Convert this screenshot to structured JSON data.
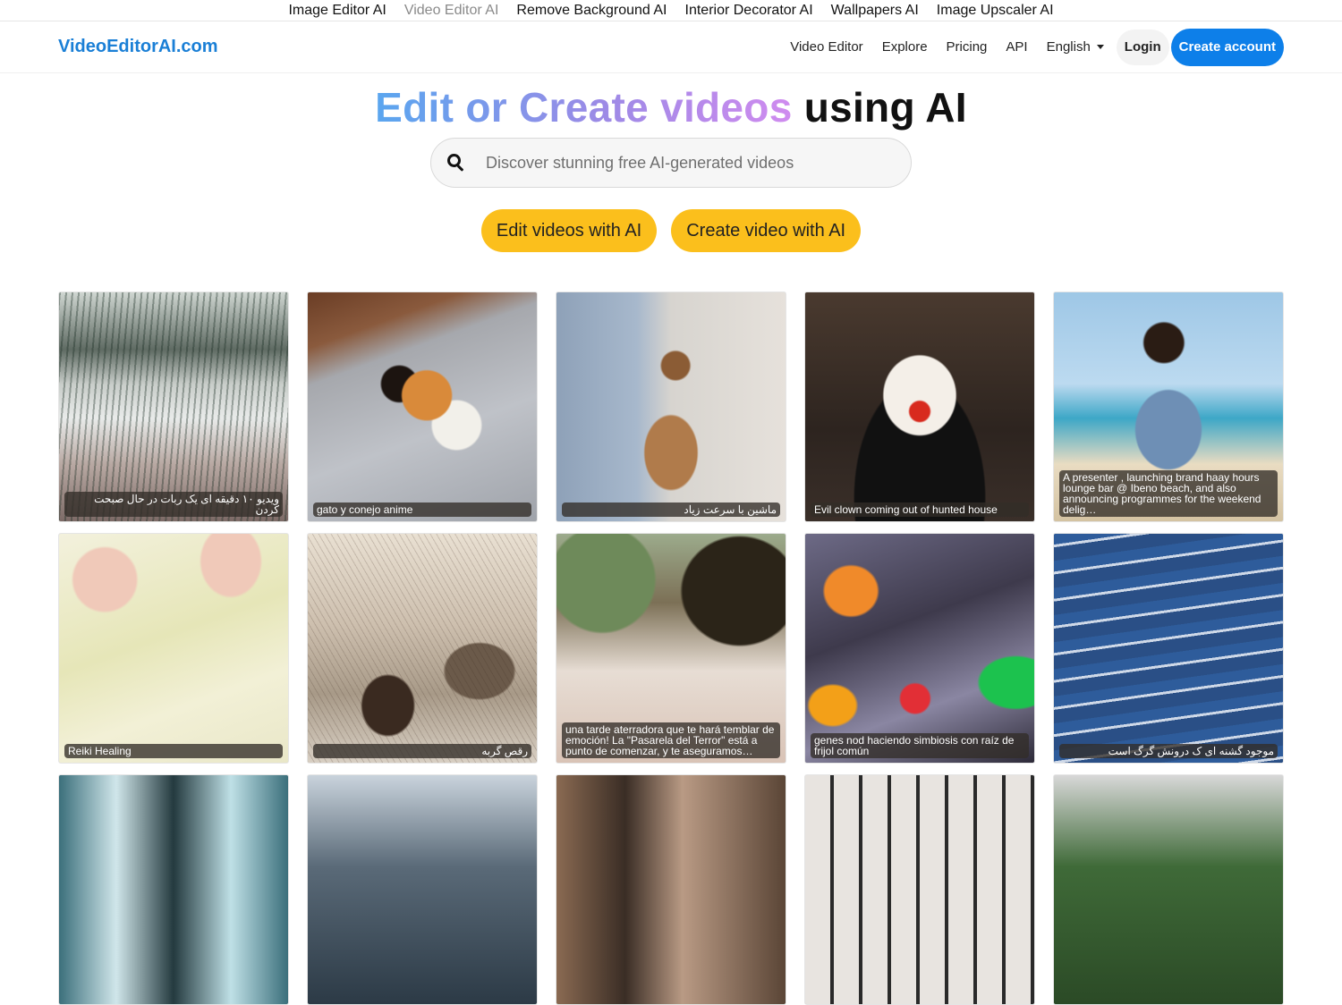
{
  "topbar": {
    "links": [
      "Image Editor AI",
      "Video Editor AI",
      "Remove Background AI",
      "Interior Decorator AI",
      "Wallpapers AI",
      "Image Upscaler AI"
    ],
    "active_index": 1
  },
  "nav": {
    "brand": "VideoEditorAI.com",
    "links": [
      "Video Editor",
      "Explore",
      "Pricing",
      "API"
    ],
    "language": "English",
    "login_label": "Login",
    "create_account_label": "Create account"
  },
  "hero": {
    "title_gradient": "Edit or Create videos",
    "title_plain": "using AI",
    "search_placeholder": "Discover stunning free AI-generated videos",
    "search_icon": "search-icon",
    "cta_edit": "Edit videos with AI",
    "cta_create": "Create video with AI"
  },
  "gallery": {
    "items": [
      {
        "caption": "ویدیو ۱۰ دقیقه ای یک ربات در حال صبحت کردن",
        "rtl": true
      },
      {
        "caption": "gato y conejo anime",
        "rtl": false
      },
      {
        "caption": "ماشین با سرعت زیاد",
        "rtl": true
      },
      {
        "caption": "Evil clown coming out of hunted house",
        "rtl": false
      },
      {
        "caption": "A presenter , launching brand haay hours lounge bar @ Ibeno beach, and also announcing programmes for the weekend delig…",
        "rtl": false
      },
      {
        "caption": "Reiki Healing",
        "rtl": false
      },
      {
        "caption": "رقص گربه",
        "rtl": true
      },
      {
        "caption": "una tarde aterradora que te hará temblar de emoción! La \"Pasarela del Terror\" está a punto de comenzar, y te aseguramos…",
        "rtl": false
      },
      {
        "caption": "genes nod haciendo simbiosis con raíz de frijol común",
        "rtl": false
      },
      {
        "caption": "موجود گشنه ای ک درونش گرگ است",
        "rtl": true
      },
      {
        "caption": "",
        "rtl": false
      },
      {
        "caption": "",
        "rtl": false
      },
      {
        "caption": "",
        "rtl": false
      },
      {
        "caption": "",
        "rtl": false
      },
      {
        "caption": "",
        "rtl": false
      }
    ]
  },
  "colors": {
    "brand": "#1a7fd6",
    "primary_button": "#0d7fe9",
    "cta": "#fbbf1c"
  }
}
